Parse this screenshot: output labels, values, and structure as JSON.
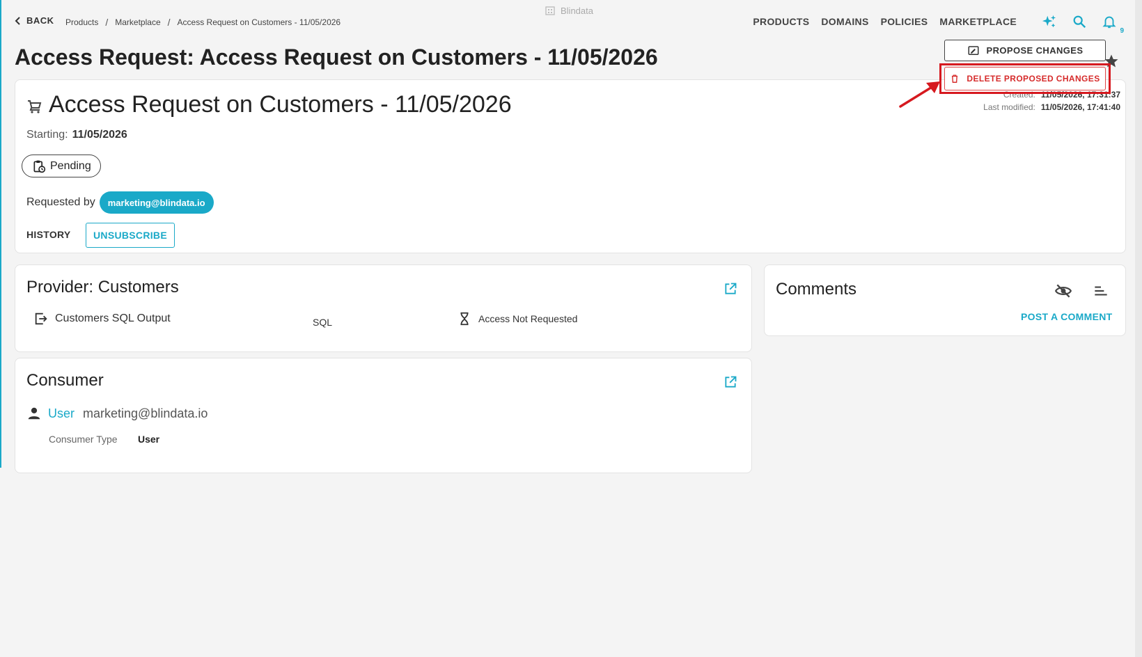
{
  "topbar": {
    "back_label": "BACK",
    "breadcrumb": [
      "Products",
      "Marketplace",
      "Access Request on Customers - 11/05/2026"
    ],
    "brand": "Blindata",
    "nav": [
      "PRODUCTS",
      "DOMAINS",
      "POLICIES",
      "MARKETPLACE"
    ],
    "notification_count": "9"
  },
  "page_title": "Access Request: Access Request on Customers - 11/05/2026",
  "request": {
    "title": "Access Request on Customers - 11/05/2026",
    "starting_label": "Starting:",
    "starting_value": "11/05/2026",
    "status": "Pending",
    "requested_by_label": "Requested by",
    "requested_by": "marketing@blindata.io",
    "history_label": "HISTORY",
    "unsubscribe_label": "UNSUBSCRIBE",
    "created_label": "Created:",
    "created_value": "11/05/2026, 17:31:37",
    "modified_label": "Last modified:",
    "modified_value": "11/05/2026, 17:41:40",
    "propose_label": "PROPOSE CHANGES",
    "delete_label": "DELETE PROPOSED CHANGES"
  },
  "provider": {
    "title": "Provider: Customers",
    "port_name": "Customers SQL Output",
    "port_type": "SQL",
    "access_status": "Access Not Requested"
  },
  "consumer": {
    "title": "Consumer",
    "kind": "User",
    "email": "marketing@blindata.io",
    "type_label": "Consumer Type",
    "type_value": "User"
  },
  "comments": {
    "title": "Comments",
    "post_label": "POST A COMMENT"
  },
  "colors": {
    "accent": "#1aa9c8",
    "danger": "#d6191f"
  }
}
